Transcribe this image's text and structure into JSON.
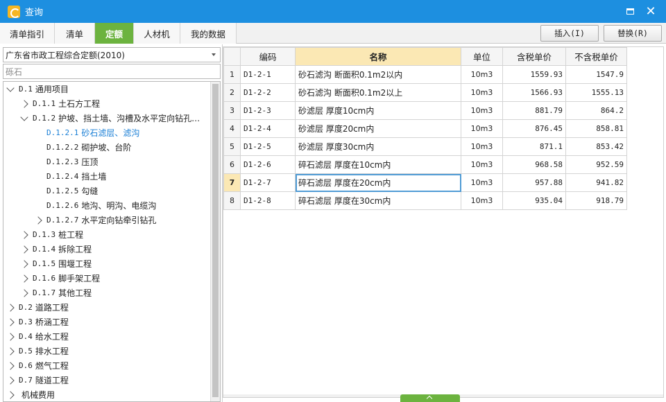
{
  "window": {
    "title": "查询"
  },
  "tabs": [
    {
      "label": "清单指引",
      "active": false
    },
    {
      "label": "清单",
      "active": false
    },
    {
      "label": "定额",
      "active": true
    },
    {
      "label": "人材机",
      "active": false
    },
    {
      "label": "我的数据",
      "active": false
    }
  ],
  "actions": {
    "insert_label": "插入(I)",
    "replace_label": "替换(R)"
  },
  "left_panel": {
    "library_select": "广东省市政工程综合定额(2010)",
    "search_value": "砾石",
    "tree": [
      {
        "code": "D.1",
        "name": "通用项目",
        "expanded": true,
        "selected": false
      },
      {
        "code": "D.1.1",
        "name": "土石方工程",
        "expanded": false,
        "selected": false
      },
      {
        "code": "D.1.2",
        "name": "护坡、挡土墙、沟槽及水平定向钻孔…",
        "expanded": true,
        "selected": false
      },
      {
        "code": "D.1.2.1",
        "name": "砂石滤层、滤沟",
        "expanded": false,
        "selected": true
      },
      {
        "code": "D.1.2.2",
        "name": "砌护坡、台阶",
        "expanded": false,
        "selected": false
      },
      {
        "code": "D.1.2.3",
        "name": "压顶",
        "expanded": false,
        "selected": false
      },
      {
        "code": "D.1.2.4",
        "name": "挡土墙",
        "expanded": false,
        "selected": false
      },
      {
        "code": "D.1.2.5",
        "name": "勾缝",
        "expanded": false,
        "selected": false
      },
      {
        "code": "D.1.2.6",
        "name": "地沟、明沟、电缆沟",
        "expanded": false,
        "selected": false
      },
      {
        "code": "D.1.2.7",
        "name": "水平定向钻牵引钻孔",
        "expanded": false,
        "selected": false
      },
      {
        "code": "D.1.3",
        "name": "桩工程",
        "expanded": false,
        "selected": false
      },
      {
        "code": "D.1.4",
        "name": "拆除工程",
        "expanded": false,
        "selected": false
      },
      {
        "code": "D.1.5",
        "name": "围堰工程",
        "expanded": false,
        "selected": false
      },
      {
        "code": "D.1.6",
        "name": "脚手架工程",
        "expanded": false,
        "selected": false
      },
      {
        "code": "D.1.7",
        "name": "其他工程",
        "expanded": false,
        "selected": false
      },
      {
        "code": "D.2",
        "name": "道路工程",
        "expanded": false,
        "selected": false
      },
      {
        "code": "D.3",
        "name": "桥涵工程",
        "expanded": false,
        "selected": false
      },
      {
        "code": "D.4",
        "name": "给水工程",
        "expanded": false,
        "selected": false
      },
      {
        "code": "D.5",
        "name": "排水工程",
        "expanded": false,
        "selected": false
      },
      {
        "code": "D.6",
        "name": "燃气工程",
        "expanded": false,
        "selected": false
      },
      {
        "code": "D.7",
        "name": "隧道工程",
        "expanded": false,
        "selected": false
      },
      {
        "code": "",
        "name": "机械费用",
        "expanded": false,
        "selected": false
      }
    ]
  },
  "grid": {
    "columns": [
      "",
      "编码",
      "名称",
      "单位",
      "含税单价",
      "不含税单价"
    ],
    "current_row": 7,
    "rows": [
      {
        "no": "1",
        "code": "D1-2-1",
        "name": "砂石滤沟 断面积0.1m2以内",
        "unit": "10m3",
        "price_tax": "1559.93",
        "price_notax": "1547.9"
      },
      {
        "no": "2",
        "code": "D1-2-2",
        "name": "砂石滤沟 断面积0.1m2以上",
        "unit": "10m3",
        "price_tax": "1566.93",
        "price_notax": "1555.13"
      },
      {
        "no": "3",
        "code": "D1-2-3",
        "name": "砂滤层 厚度10cm内",
        "unit": "10m3",
        "price_tax": "881.79",
        "price_notax": "864.2"
      },
      {
        "no": "4",
        "code": "D1-2-4",
        "name": "砂滤层 厚度20cm内",
        "unit": "10m3",
        "price_tax": "876.45",
        "price_notax": "858.81"
      },
      {
        "no": "5",
        "code": "D1-2-5",
        "name": "砂滤层 厚度30cm内",
        "unit": "10m3",
        "price_tax": "871.1",
        "price_notax": "853.42"
      },
      {
        "no": "6",
        "code": "D1-2-6",
        "name": "碎石滤层 厚度在10cm内",
        "unit": "10m3",
        "price_tax": "968.58",
        "price_notax": "952.59"
      },
      {
        "no": "7",
        "code": "D1-2-7",
        "name": "碎石滤层 厚度在20cm内",
        "unit": "10m3",
        "price_tax": "957.88",
        "price_notax": "941.82"
      },
      {
        "no": "8",
        "code": "D1-2-8",
        "name": "碎石滤层 厚度在30cm内",
        "unit": "10m3",
        "price_tax": "935.04",
        "price_notax": "918.79"
      }
    ]
  },
  "colors": {
    "titlebar": "#1d8fe0",
    "active_tab": "#6cb33f",
    "header_highlight": "#fbe8b4",
    "selected_tree_text": "#1a7fd6"
  }
}
